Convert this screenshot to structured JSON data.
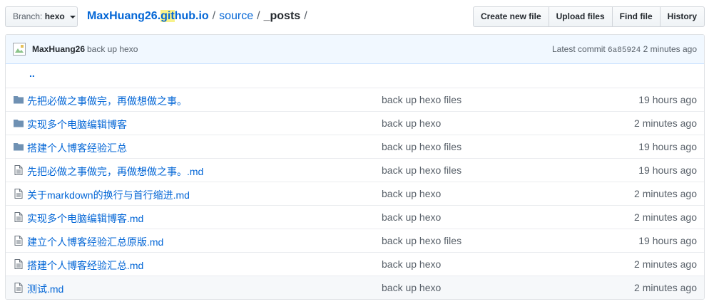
{
  "branch": {
    "prefix": "Branch:",
    "name": "hexo"
  },
  "breadcrumb": {
    "repo_part1": "MaxHuang26.",
    "repo_highlight": "git",
    "repo_part2": "hub.io",
    "separator": "/",
    "folder": "source",
    "current": "_posts"
  },
  "actions": {
    "create_new_file": "Create new file",
    "upload_files": "Upload files",
    "find_file": "Find file",
    "history": "History"
  },
  "commit": {
    "author": "MaxHuang26",
    "message": "back up hexo",
    "latest_label": "Latest commit",
    "sha": "6a85924",
    "age": "2 minutes ago"
  },
  "parent_dir": "..",
  "files": [
    {
      "type": "folder",
      "name": "先把必做之事做完，再做想做之事。",
      "message": "back up hexo files",
      "age": "19 hours ago"
    },
    {
      "type": "folder",
      "name": "实现多个电脑编辑博客",
      "message": "back up hexo",
      "age": "2 minutes ago"
    },
    {
      "type": "folder",
      "name": "搭建个人博客经验汇总",
      "message": "back up hexo files",
      "age": "19 hours ago"
    },
    {
      "type": "file",
      "name": "先把必做之事做完，再做想做之事。.md",
      "message": "back up hexo files",
      "age": "19 hours ago"
    },
    {
      "type": "file",
      "name": "关于markdown的换行与首行缩进.md",
      "message": "back up hexo",
      "age": "2 minutes ago"
    },
    {
      "type": "file",
      "name": "实现多个电脑编辑博客.md",
      "message": "back up hexo",
      "age": "2 minutes ago"
    },
    {
      "type": "file",
      "name": "建立个人博客经验汇总原版.md",
      "message": "back up hexo files",
      "age": "19 hours ago"
    },
    {
      "type": "file",
      "name": "搭建个人博客经验汇总.md",
      "message": "back up hexo",
      "age": "2 minutes ago"
    },
    {
      "type": "file",
      "name": "测试.md",
      "message": "back up hexo",
      "age": "2 minutes ago"
    }
  ],
  "icons": {
    "folder": "folder-icon",
    "file": "file-icon",
    "branch_dropdown": "caret-down-icon"
  },
  "colors": {
    "link": "#0366d6",
    "folder_icon": "#79b8ff",
    "file_icon": "#6a737d",
    "commit_bar_bg": "#f1f8ff"
  }
}
